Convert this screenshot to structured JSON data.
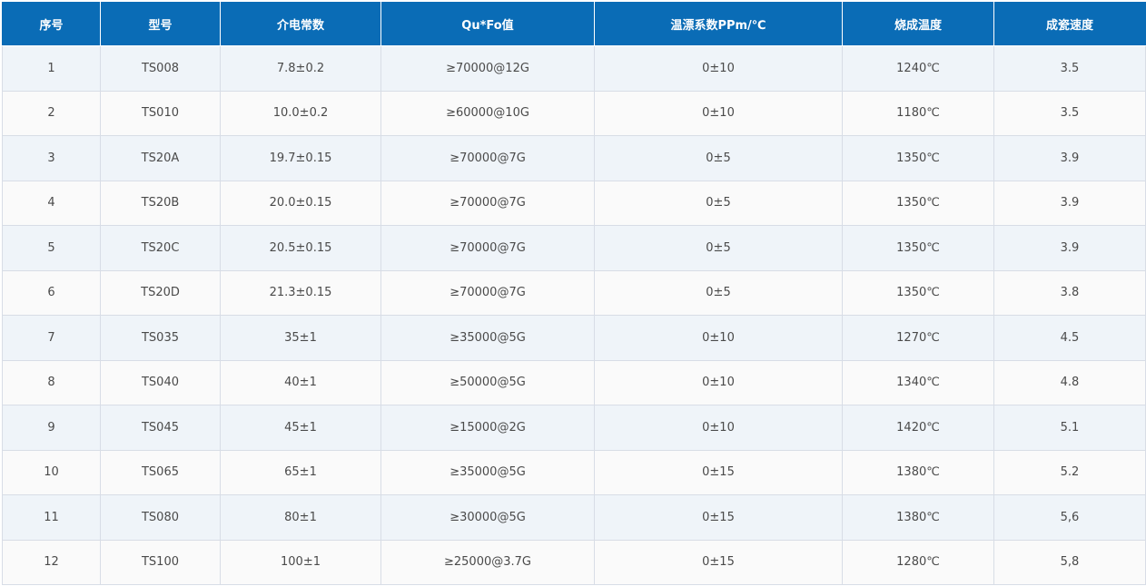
{
  "table": {
    "headers": [
      "序号",
      "型号",
      "介电常数",
      "Qu*Fo值",
      "温漂系数PPm/℃",
      "烧成温度",
      "成瓷速度"
    ],
    "rows": [
      [
        "1",
        "TS008",
        "7.8±0.2",
        "≥70000@12G",
        "0±10",
        "1240℃",
        "3.5"
      ],
      [
        "2",
        "TS010",
        "10.0±0.2",
        "≥60000@10G",
        "0±10",
        "1180℃",
        "3.5"
      ],
      [
        "3",
        "TS20A",
        "19.7±0.15",
        "≥70000@7G",
        "0±5",
        "1350℃",
        "3.9"
      ],
      [
        "4",
        "TS20B",
        "20.0±0.15",
        "≥70000@7G",
        "0±5",
        "1350℃",
        "3.9"
      ],
      [
        "5",
        "TS20C",
        "20.5±0.15",
        "≥70000@7G",
        "0±5",
        "1350℃",
        "3.9"
      ],
      [
        "6",
        "TS20D",
        "21.3±0.15",
        "≥70000@7G",
        "0±5",
        "1350℃",
        "3.8"
      ],
      [
        "7",
        "TS035",
        "35±1",
        "≥35000@5G",
        "0±10",
        "1270℃",
        "4.5"
      ],
      [
        "8",
        "TS040",
        "40±1",
        "≥50000@5G",
        "0±10",
        "1340℃",
        "4.8"
      ],
      [
        "9",
        "TS045",
        "45±1",
        "≥15000@2G",
        "0±10",
        "1420℃",
        "5.1"
      ],
      [
        "10",
        "TS065",
        "65±1",
        "≥35000@5G",
        "0±15",
        "1380℃",
        "5.2"
      ],
      [
        "11",
        "TS080",
        "80±1",
        "≥30000@5G",
        "0±15",
        "1380℃",
        "5,6"
      ],
      [
        "12",
        "TS100",
        "100±1",
        "≥25000@3.7G",
        "0±15",
        "1280℃",
        "5,8"
      ]
    ]
  },
  "colors": {
    "header_bg": "#0a6cb6",
    "header_text": "#ffffff",
    "row_odd_bg": "#eff4f9",
    "row_even_bg": "#fafafa",
    "cell_text": "#4a4a4a"
  }
}
